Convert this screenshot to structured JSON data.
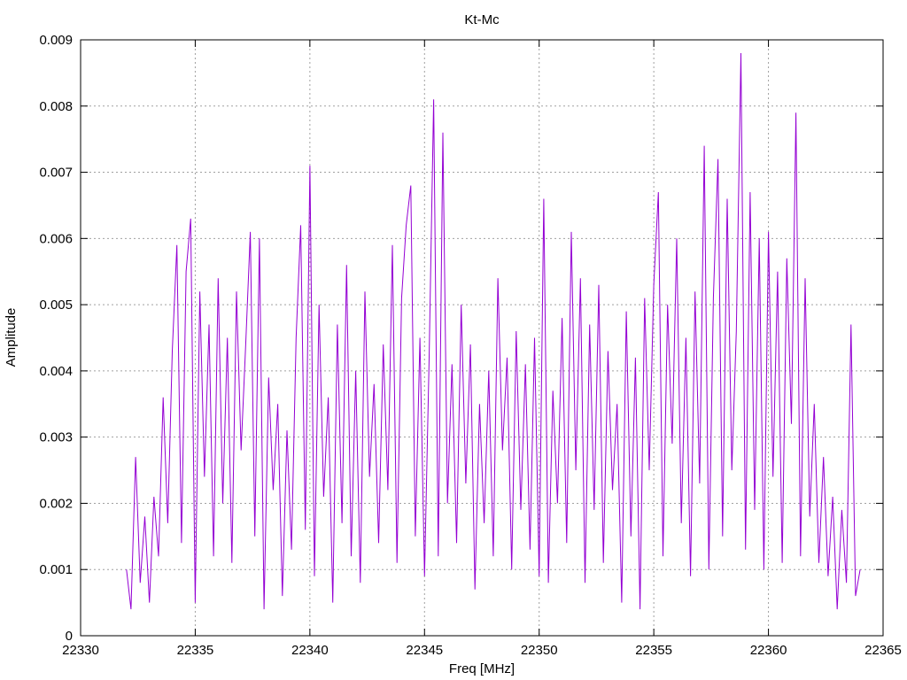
{
  "chart_data": {
    "type": "line",
    "title": "Kt-Mc",
    "xlabel": "Freq [MHz]",
    "ylabel": "Amplitude",
    "xlim": [
      22330,
      22365
    ],
    "ylim": [
      0,
      0.009
    ],
    "xticks": [
      22330,
      22335,
      22340,
      22345,
      22350,
      22355,
      22360,
      22365
    ],
    "yticks": [
      0,
      0.001,
      0.002,
      0.003,
      0.004,
      0.005,
      0.006,
      0.007,
      0.008,
      0.009
    ],
    "xtick_labels": [
      "22330",
      "22335",
      "22340",
      "22345",
      "22350",
      "22355",
      "22360",
      "22365"
    ],
    "ytick_labels": [
      "0",
      "0.001",
      "0.002",
      "0.003",
      "0.004",
      "0.005",
      "0.006",
      "0.007",
      "0.008",
      "0.009"
    ],
    "grid": true,
    "series": [
      {
        "name": "Kt-Mc",
        "color": "#9400d3",
        "x_start": 22332.0,
        "x_step": 0.2,
        "values": [
          0.001,
          0.0004,
          0.0027,
          0.0008,
          0.0018,
          0.0005,
          0.0021,
          0.0012,
          0.0036,
          0.0017,
          0.0043,
          0.0059,
          0.0014,
          0.0055,
          0.0063,
          0.0005,
          0.0052,
          0.0024,
          0.0047,
          0.0012,
          0.0054,
          0.002,
          0.0045,
          0.0011,
          0.0052,
          0.0028,
          0.0044,
          0.0061,
          0.0015,
          0.006,
          0.0004,
          0.0039,
          0.0022,
          0.0035,
          0.0006,
          0.0031,
          0.0013,
          0.0045,
          0.0062,
          0.0016,
          0.0071,
          0.0009,
          0.005,
          0.0021,
          0.0036,
          0.0005,
          0.0047,
          0.0017,
          0.0056,
          0.0012,
          0.004,
          0.0008,
          0.0052,
          0.0024,
          0.0038,
          0.0014,
          0.0044,
          0.0022,
          0.0059,
          0.0011,
          0.0051,
          0.0062,
          0.0068,
          0.0015,
          0.0045,
          0.0009,
          0.0042,
          0.0081,
          0.0012,
          0.0076,
          0.002,
          0.0041,
          0.0014,
          0.005,
          0.0023,
          0.0044,
          0.0007,
          0.0035,
          0.0017,
          0.004,
          0.0012,
          0.0054,
          0.0028,
          0.0042,
          0.001,
          0.0046,
          0.0019,
          0.0041,
          0.0013,
          0.0045,
          0.0009,
          0.0066,
          0.0008,
          0.0037,
          0.002,
          0.0048,
          0.0014,
          0.0061,
          0.0025,
          0.0054,
          0.0008,
          0.0047,
          0.0019,
          0.0053,
          0.0011,
          0.0043,
          0.0022,
          0.0035,
          0.0005,
          0.0049,
          0.0015,
          0.0042,
          0.0004,
          0.0051,
          0.0025,
          0.0053,
          0.0067,
          0.0012,
          0.005,
          0.0029,
          0.006,
          0.0017,
          0.0045,
          0.0009,
          0.0052,
          0.0023,
          0.0074,
          0.001,
          0.0051,
          0.0072,
          0.0015,
          0.0066,
          0.0025,
          0.0046,
          0.0088,
          0.0013,
          0.0067,
          0.0019,
          0.006,
          0.001,
          0.0061,
          0.0024,
          0.0055,
          0.0011,
          0.0057,
          0.0032,
          0.0079,
          0.0012,
          0.0054,
          0.0018,
          0.0035,
          0.0011,
          0.0027,
          0.0009,
          0.0021,
          0.0004,
          0.0019,
          0.0008,
          0.0047,
          0.0006,
          0.001
        ]
      }
    ]
  }
}
